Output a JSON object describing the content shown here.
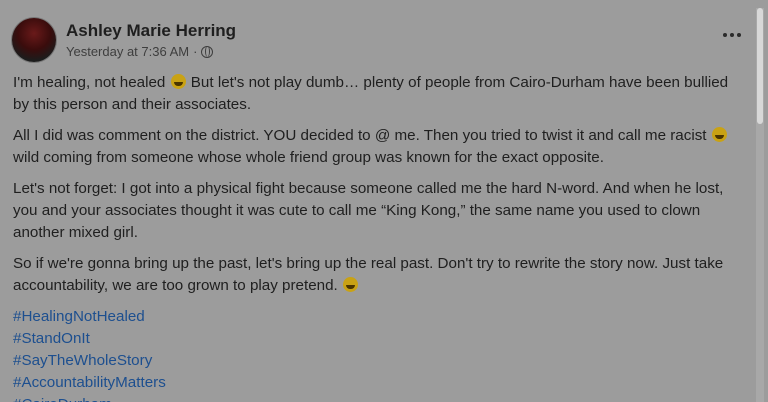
{
  "post": {
    "author": "Ashley Marie Herring",
    "timestamp": "Yesterday at 7:36 AM",
    "separator": "·",
    "privacy_icon": "globe-icon",
    "more_icon": "more-options-icon",
    "paragraphs": {
      "p1_a": "I'm healing, not healed ",
      "p1_emoji": "grimacing-face",
      "p1_b": " But let's not play dumb… plenty of people from Cairo-Durham have been bullied by this person and their associates.",
      "p2_a": "All I did was comment on the district. YOU decided to @ me. Then you tried to twist it and call me racist ",
      "p2_emoji": "laughing-face",
      "p2_b": " wild coming from someone whose whole friend group was known for the exact opposite.",
      "p3": "Let's not forget: I got into a physical fight because someone called me the hard N-word. And when he lost, you and your associates thought it was cute to call me “King Kong,” the same name you used to clown another mixed girl.",
      "p4_a": "So if we're gonna bring up the past, let's bring up the real past. Don't try to rewrite the story now. Just take accountability, we are too grown to play pretend. ",
      "p4_emoji": "laughing-face"
    },
    "hashtags": [
      "#HealingNotHealed",
      "#StandOnIt",
      "#SayTheWholeStory",
      "#AccountabilityMatters",
      "#CairoDurham"
    ]
  },
  "colors": {
    "overlay_tint": "#9c9c9c",
    "hashtag_link": "#1d4f8f",
    "text": "#1f1f1f"
  }
}
